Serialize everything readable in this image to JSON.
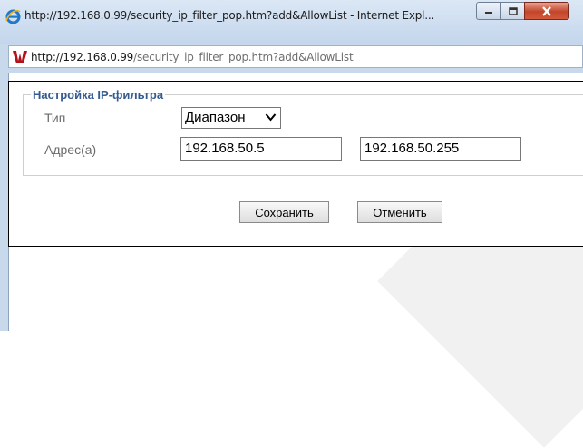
{
  "window": {
    "title": "http://192.168.0.99/security_ip_filter_pop.htm?add&AllowList - Internet Expl...",
    "address_host": "http://192.168.0.99",
    "address_path": "/security_ip_filter_pop.htm?add&AllowList"
  },
  "form": {
    "legend": "Настройка IP-фильтра",
    "type_label": "Тип",
    "type_value": "Диапазон",
    "address_label": "Адрес(а)",
    "address_from": "192.168.50.5",
    "range_separator": "-",
    "address_to": "192.168.50.255"
  },
  "buttons": {
    "save": "Сохранить",
    "cancel": "Отменить"
  },
  "colors": {
    "legend": "#335b8f",
    "close_button": "#c2452a"
  },
  "icons": {
    "browser": "internet-explorer-icon",
    "site": "site-favicon",
    "minimize": "minimize-icon",
    "maximize": "maximize-icon",
    "close": "close-icon",
    "dropdown": "chevron-down-icon"
  }
}
